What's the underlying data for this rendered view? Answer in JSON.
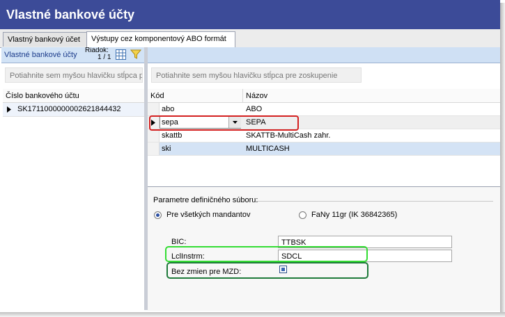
{
  "window": {
    "title": "Vlastné bankové účty"
  },
  "tabs": [
    {
      "label": "Vlastný bankový účet"
    },
    {
      "label": "Výstupy cez komponentový ABO formát"
    }
  ],
  "left_panel": {
    "header": "Vlastné bankové účty",
    "row_label": "Riadok:",
    "row_value": "1 / 1",
    "group_hint": "Potiahnite sem myšou hlavičku stĺpca pre zoskupenie",
    "column": "Číslo bankového účtu",
    "rows": [
      "SK1711000000002621844432"
    ]
  },
  "right_panel": {
    "group_hint": "Potiahnite sem myšou hlavičku stĺpca pre zoskupenie",
    "columns": {
      "code": "Kód",
      "name": "Názov"
    },
    "rows": [
      {
        "code": "abo",
        "name": "ABO"
      },
      {
        "code": "sepa",
        "name": "SEPA"
      },
      {
        "code": "skattb",
        "name": "SKATTB-MultiCash zahr."
      },
      {
        "code": "ski",
        "name": "MULTICASH"
      }
    ]
  },
  "params": {
    "group_title": "Parametre definičného súboru:",
    "radio_all": "Pre všetkých mandantov",
    "radio_company": "FaNy 11gr (IK 36842365)",
    "bic_label": "BIC:",
    "bic_value": "TTBSK",
    "lcl_label": "LclInstrm:",
    "lcl_value": "SDCL",
    "mzd_label": "Bez zmien pre MZD:"
  },
  "colors": {
    "title_bar": "#3c4b98",
    "highlight_red": "#d42020",
    "highlight_lightgreen": "#33dd33",
    "highlight_darkgreen": "#1e7a3a"
  }
}
